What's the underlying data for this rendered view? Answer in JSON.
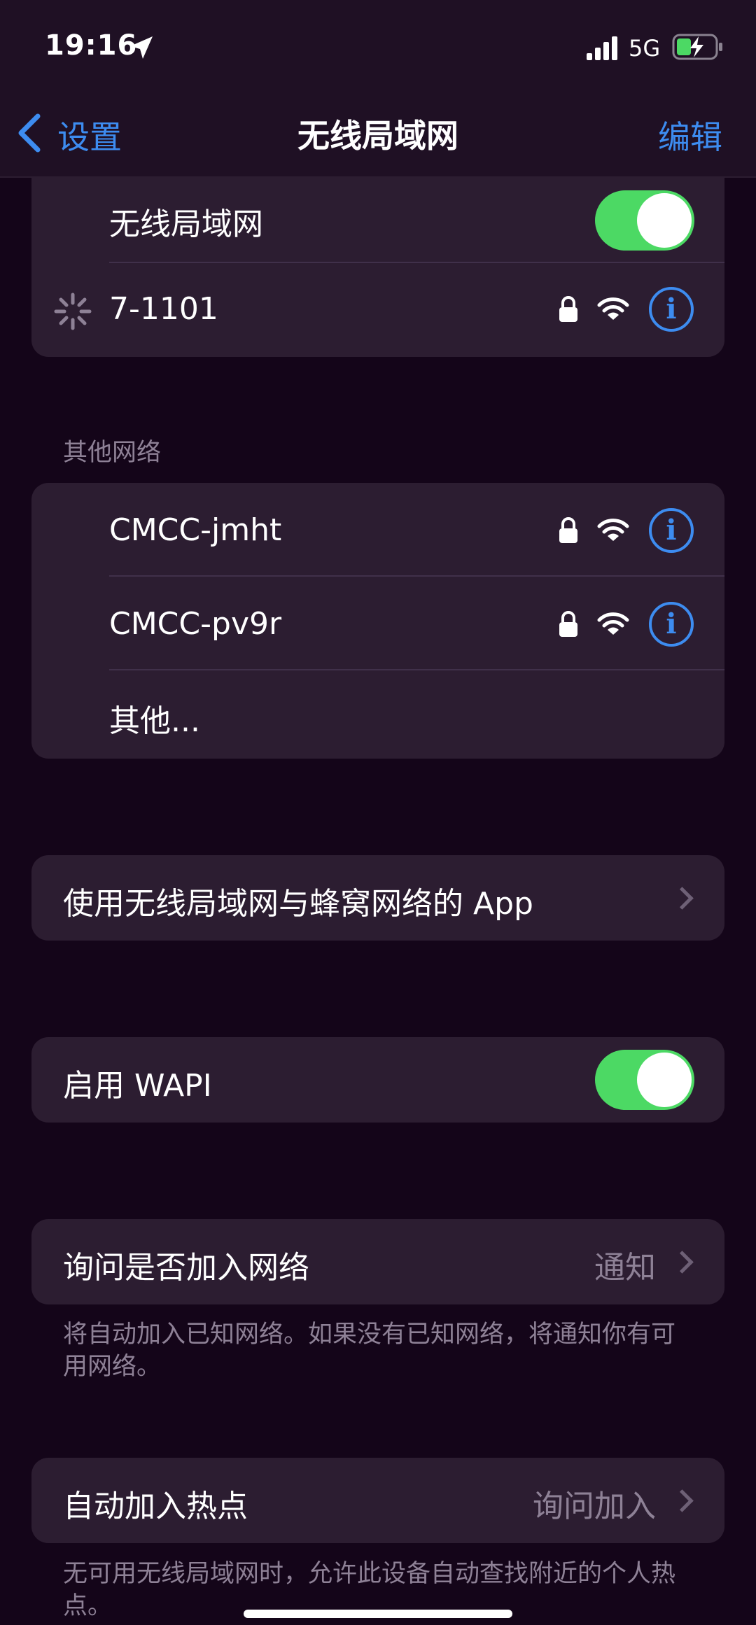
{
  "status_bar": {
    "time": "19:16",
    "network": "5G"
  },
  "nav": {
    "back_label": "设置",
    "title": "无线局域网",
    "edit_label": "编辑"
  },
  "wifi_card": {
    "toggle_label": "无线局域网",
    "toggle_on": true,
    "current_network": "7-1101"
  },
  "other_networks": {
    "header": "其他网络",
    "items": [
      {
        "name": "CMCC-jmht"
      },
      {
        "name": "CMCC-pv9r"
      }
    ],
    "other_label": "其他..."
  },
  "apps_row": {
    "label": "使用无线局域网与蜂窝网络的 App"
  },
  "wapi_row": {
    "label": "启用 WAPI",
    "toggle_on": true
  },
  "ask_join": {
    "label": "询问是否加入网络",
    "value": "通知",
    "footnote": "将自动加入已知网络。如果没有已知网络，将通知你有可用网络。"
  },
  "auto_hotspot": {
    "label": "自动加入热点",
    "value": "询问加入",
    "footnote": "无可用无线局域网时，允许此设备自动查找附近的个人热点。"
  },
  "colors": {
    "accent": "#3d8cf0",
    "toggle_green": "#4cd964",
    "background": "#140519",
    "card": "#2c1d31"
  },
  "icons": [
    "location-arrow-icon",
    "signal-dots-icon",
    "battery-charging-icon",
    "chevron-left-icon",
    "lock-icon",
    "wifi-icon",
    "info-icon",
    "spinner-icon",
    "chevron-right-icon"
  ]
}
